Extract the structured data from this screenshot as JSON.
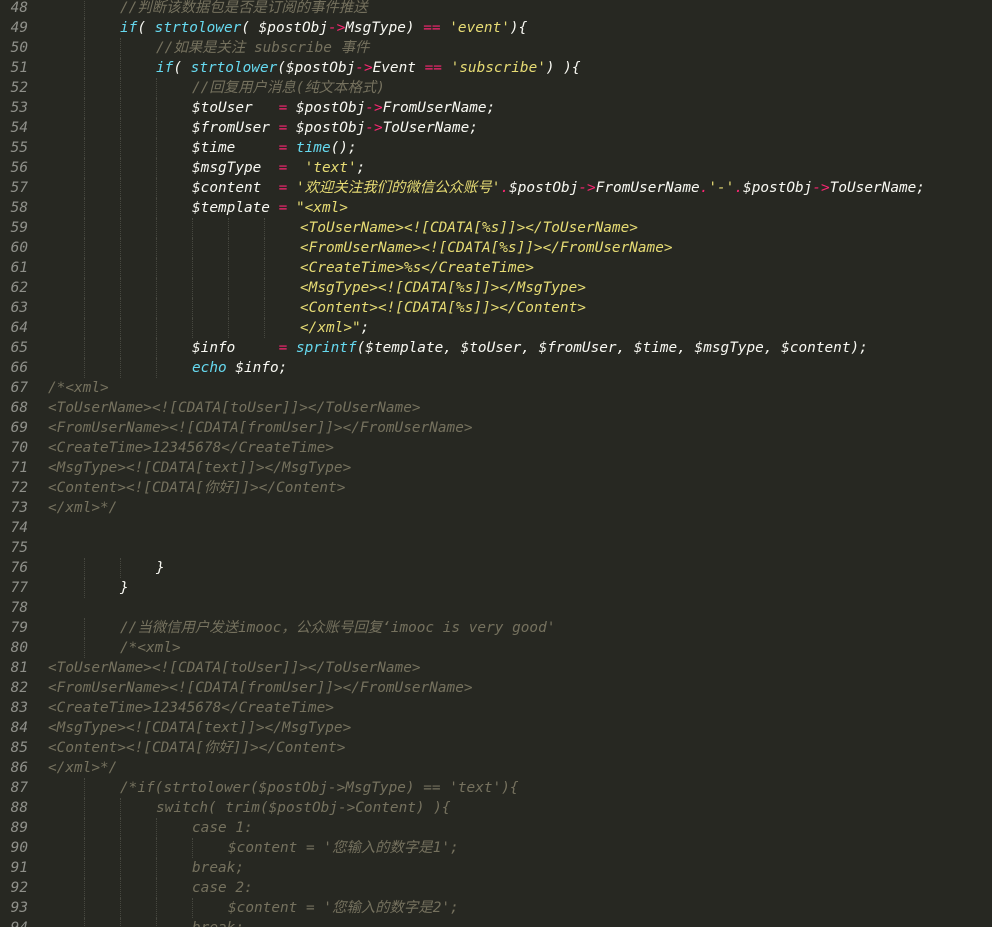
{
  "editor": {
    "theme": {
      "background": "#272822",
      "foreground": "#f8f8f2",
      "comment": "#75715e",
      "keyword": "#66d9ef",
      "operator": "#f92672",
      "string": "#e6db74",
      "line_number": "#8f908a"
    },
    "lines": [
      {
        "n": "48",
        "indent": 2,
        "tokens": [
          [
            "cm",
            "//判断该数据包是否是订阅的事件推送"
          ]
        ]
      },
      {
        "n": "49",
        "indent": 2,
        "tokens": [
          [
            "kw",
            "if"
          ],
          [
            "pl",
            "( "
          ],
          [
            "fn",
            "strtolower"
          ],
          [
            "pl",
            "( $postObj"
          ],
          [
            "op",
            "->"
          ],
          [
            "pl",
            "MsgType) "
          ],
          [
            "op",
            "=="
          ],
          [
            "pl",
            " "
          ],
          [
            "st",
            "'event'"
          ],
          [
            "pl",
            "){"
          ]
        ]
      },
      {
        "n": "50",
        "indent": 3,
        "tokens": [
          [
            "cm",
            "//如果是关注 subscribe 事件"
          ]
        ]
      },
      {
        "n": "51",
        "indent": 3,
        "tokens": [
          [
            "kw",
            "if"
          ],
          [
            "pl",
            "( "
          ],
          [
            "fn",
            "strtolower"
          ],
          [
            "pl",
            "($postObj"
          ],
          [
            "op",
            "->"
          ],
          [
            "pl",
            "Event "
          ],
          [
            "op",
            "=="
          ],
          [
            "pl",
            " "
          ],
          [
            "st",
            "'subscribe'"
          ],
          [
            "pl",
            ") ){"
          ]
        ]
      },
      {
        "n": "52",
        "indent": 4,
        "tokens": [
          [
            "cm",
            "//回复用户消息(纯文本格式)"
          ]
        ]
      },
      {
        "n": "53",
        "indent": 4,
        "tokens": [
          [
            "va",
            "$toUser   "
          ],
          [
            "op",
            "="
          ],
          [
            "pl",
            " $postObj"
          ],
          [
            "op",
            "->"
          ],
          [
            "pl",
            "FromUserName;"
          ]
        ]
      },
      {
        "n": "54",
        "indent": 4,
        "tokens": [
          [
            "va",
            "$fromUser "
          ],
          [
            "op",
            "="
          ],
          [
            "pl",
            " $postObj"
          ],
          [
            "op",
            "->"
          ],
          [
            "pl",
            "ToUserName;"
          ]
        ]
      },
      {
        "n": "55",
        "indent": 4,
        "tokens": [
          [
            "va",
            "$time     "
          ],
          [
            "op",
            "="
          ],
          [
            "pl",
            " "
          ],
          [
            "fn",
            "time"
          ],
          [
            "pl",
            "();"
          ]
        ]
      },
      {
        "n": "56",
        "indent": 4,
        "tokens": [
          [
            "va",
            "$msgType  "
          ],
          [
            "op",
            "="
          ],
          [
            "pl",
            "  "
          ],
          [
            "st",
            "'text'"
          ],
          [
            "pl",
            ";"
          ]
        ]
      },
      {
        "n": "57",
        "indent": 4,
        "tokens": [
          [
            "va",
            "$content  "
          ],
          [
            "op",
            "="
          ],
          [
            "pl",
            " "
          ],
          [
            "st",
            "'欢迎关注我们的微信公众账号'"
          ],
          [
            "op",
            "."
          ],
          [
            "pl",
            "$postObj"
          ],
          [
            "op",
            "->"
          ],
          [
            "pl",
            "FromUserName"
          ],
          [
            "op",
            "."
          ],
          [
            "st",
            "'-'"
          ],
          [
            "op",
            "."
          ],
          [
            "pl",
            "$postObj"
          ],
          [
            "op",
            "->"
          ],
          [
            "pl",
            "ToUserName;"
          ]
        ]
      },
      {
        "n": "58",
        "indent": 4,
        "tokens": [
          [
            "va",
            "$template "
          ],
          [
            "op",
            "="
          ],
          [
            "pl",
            " "
          ],
          [
            "st",
            "\"<xml>"
          ]
        ]
      },
      {
        "n": "59",
        "indent": 7,
        "tokens": [
          [
            "st",
            "<ToUserName><![CDATA[%s]]></ToUserName>"
          ]
        ]
      },
      {
        "n": "60",
        "indent": 7,
        "tokens": [
          [
            "st",
            "<FromUserName><![CDATA[%s]]></FromUserName>"
          ]
        ]
      },
      {
        "n": "61",
        "indent": 7,
        "tokens": [
          [
            "st",
            "<CreateTime>%s</CreateTime>"
          ]
        ]
      },
      {
        "n": "62",
        "indent": 7,
        "tokens": [
          [
            "st",
            "<MsgType><![CDATA[%s]]></MsgType>"
          ]
        ]
      },
      {
        "n": "63",
        "indent": 7,
        "tokens": [
          [
            "st",
            "<Content><![CDATA[%s]]></Content>"
          ]
        ]
      },
      {
        "n": "64",
        "indent": 7,
        "tokens": [
          [
            "st",
            "</xml>\""
          ],
          [
            "pl",
            ";"
          ]
        ]
      },
      {
        "n": "65",
        "indent": 4,
        "tokens": [
          [
            "va",
            "$info     "
          ],
          [
            "op",
            "="
          ],
          [
            "pl",
            " "
          ],
          [
            "fn",
            "sprintf"
          ],
          [
            "pl",
            "($template, $toUser, $fromUser, $time, $msgType, $content);"
          ]
        ]
      },
      {
        "n": "66",
        "indent": 4,
        "tokens": [
          [
            "kw",
            "echo"
          ],
          [
            "pl",
            " $info;"
          ]
        ]
      },
      {
        "n": "67",
        "indent": 0,
        "tokens": [
          [
            "cm",
            "/*<xml>"
          ]
        ]
      },
      {
        "n": "68",
        "indent": 0,
        "tokens": [
          [
            "cm",
            "<ToUserName><![CDATA[toUser]]></ToUserName>"
          ]
        ]
      },
      {
        "n": "69",
        "indent": 0,
        "tokens": [
          [
            "cm",
            "<FromUserName><![CDATA[fromUser]]></FromUserName>"
          ]
        ]
      },
      {
        "n": "70",
        "indent": 0,
        "tokens": [
          [
            "cm",
            "<CreateTime>12345678</CreateTime>"
          ]
        ]
      },
      {
        "n": "71",
        "indent": 0,
        "tokens": [
          [
            "cm",
            "<MsgType><![CDATA[text]]></MsgType>"
          ]
        ]
      },
      {
        "n": "72",
        "indent": 0,
        "tokens": [
          [
            "cm",
            "<Content><![CDATA[你好]]></Content>"
          ]
        ]
      },
      {
        "n": "73",
        "indent": 0,
        "tokens": [
          [
            "cm",
            "</xml>*/"
          ]
        ]
      },
      {
        "n": "74",
        "indent": 0,
        "tokens": []
      },
      {
        "n": "75",
        "indent": 0,
        "tokens": []
      },
      {
        "n": "76",
        "indent": 3,
        "tokens": [
          [
            "pl",
            "}"
          ]
        ]
      },
      {
        "n": "77",
        "indent": 2,
        "tokens": [
          [
            "pl",
            "}"
          ]
        ]
      },
      {
        "n": "78",
        "indent": 0,
        "tokens": []
      },
      {
        "n": "79",
        "indent": 2,
        "tokens": [
          [
            "cm",
            "//当微信用户发送imooc，公众账号回复‘imooc is very good'"
          ]
        ]
      },
      {
        "n": "80",
        "indent": 2,
        "tokens": [
          [
            "cm",
            "/*<xml>"
          ]
        ]
      },
      {
        "n": "81",
        "indent": 0,
        "tokens": [
          [
            "cm",
            "<ToUserName><![CDATA[toUser]]></ToUserName>"
          ]
        ]
      },
      {
        "n": "82",
        "indent": 0,
        "tokens": [
          [
            "cm",
            "<FromUserName><![CDATA[fromUser]]></FromUserName>"
          ]
        ]
      },
      {
        "n": "83",
        "indent": 0,
        "tokens": [
          [
            "cm",
            "<CreateTime>12345678</CreateTime>"
          ]
        ]
      },
      {
        "n": "84",
        "indent": 0,
        "tokens": [
          [
            "cm",
            "<MsgType><![CDATA[text]]></MsgType>"
          ]
        ]
      },
      {
        "n": "85",
        "indent": 0,
        "tokens": [
          [
            "cm",
            "<Content><![CDATA[你好]]></Content>"
          ]
        ]
      },
      {
        "n": "86",
        "indent": 0,
        "tokens": [
          [
            "cm",
            "</xml>*/"
          ]
        ]
      },
      {
        "n": "87",
        "indent": 2,
        "tokens": [
          [
            "cm",
            "/*if(strtolower($postObj->MsgType) == 'text'){"
          ]
        ]
      },
      {
        "n": "88",
        "indent": 3,
        "tokens": [
          [
            "cm",
            "switch( trim($postObj->Content) ){"
          ]
        ]
      },
      {
        "n": "89",
        "indent": 4,
        "tokens": [
          [
            "cm",
            "case 1:"
          ]
        ]
      },
      {
        "n": "90",
        "indent": 5,
        "tokens": [
          [
            "cm",
            "$content = '您输入的数字是1';"
          ]
        ]
      },
      {
        "n": "91",
        "indent": 4,
        "tokens": [
          [
            "cm",
            "break;"
          ]
        ]
      },
      {
        "n": "92",
        "indent": 4,
        "tokens": [
          [
            "cm",
            "case 2:"
          ]
        ]
      },
      {
        "n": "93",
        "indent": 5,
        "tokens": [
          [
            "cm",
            "$content = '您输入的数字是2';"
          ]
        ]
      },
      {
        "n": "94",
        "indent": 4,
        "tokens": [
          [
            "cm",
            "break;"
          ]
        ]
      }
    ]
  }
}
